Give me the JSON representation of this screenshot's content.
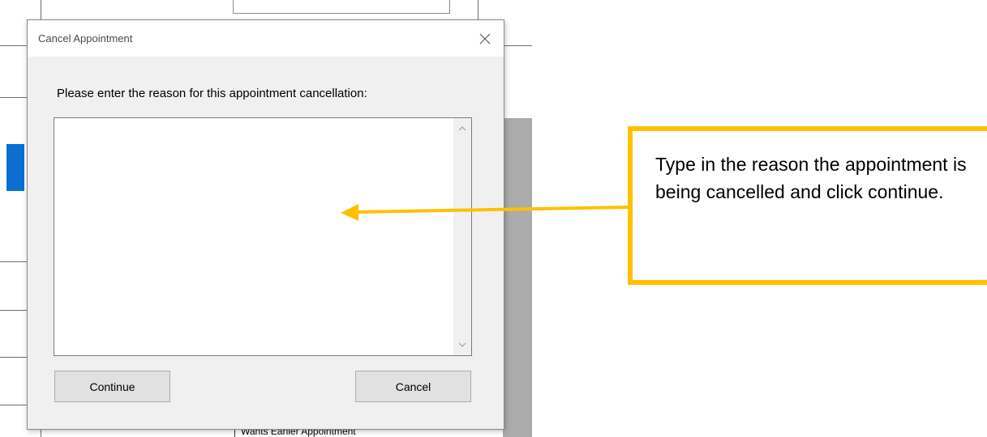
{
  "dialog": {
    "title": "Cancel Appointment",
    "prompt": "Please enter the reason for this appointment cancellation:",
    "reason_value": "",
    "continue_label": "Continue",
    "cancel_label": "Cancel"
  },
  "background": {
    "list_item": "Wants Earlier Appointment"
  },
  "callout": {
    "text": "Type in the reason the appointment is being cancelled and click continue.",
    "color": "#ffc000"
  },
  "icons": {
    "close": "close-icon",
    "scroll_up": "chevron-up-icon",
    "scroll_down": "chevron-down-icon",
    "arrow": "arrow-left-icon"
  }
}
